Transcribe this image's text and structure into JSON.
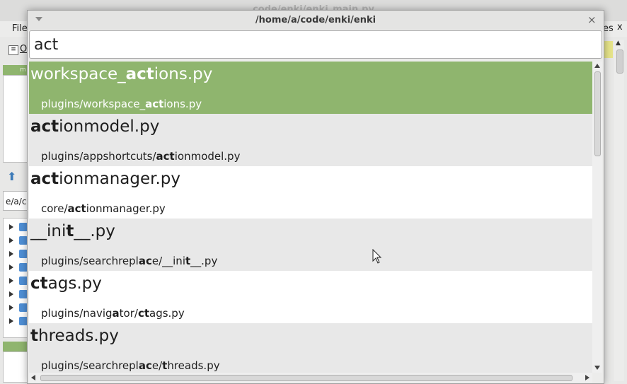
{
  "background_window": {
    "title": "code/enki/enki_main.py",
    "menu_file": "File",
    "menu_right": "es",
    "close": "x",
    "toolbar_text": "O",
    "panel_header": "m",
    "path_field": "e/a/co"
  },
  "dialog": {
    "title": "/home/a/code/enki/enki",
    "search": {
      "value": "act",
      "placeholder": ""
    },
    "colors": {
      "selected": "#8fb56e",
      "row_alt": "#e8e8e8"
    },
    "items": [
      {
        "name_parts": [
          [
            "workspace_",
            false
          ],
          [
            "act",
            true
          ],
          [
            "ions.py",
            false
          ]
        ],
        "path_parts": [
          [
            "plugins/workspace_",
            false
          ],
          [
            "act",
            true
          ],
          [
            "ions.py",
            false
          ]
        ],
        "selected": true
      },
      {
        "name_parts": [
          [
            "act",
            true
          ],
          [
            "ionmodel.py",
            false
          ]
        ],
        "path_parts": [
          [
            "plugins/appshortcuts/",
            false
          ],
          [
            "act",
            true
          ],
          [
            "ionmodel.py",
            false
          ]
        ],
        "selected": false
      },
      {
        "name_parts": [
          [
            "act",
            true
          ],
          [
            "ionmanager.py",
            false
          ]
        ],
        "path_parts": [
          [
            "core/",
            false
          ],
          [
            "act",
            true
          ],
          [
            "ionmanager.py",
            false
          ]
        ],
        "selected": false
      },
      {
        "name_parts": [
          [
            "__ini",
            false
          ],
          [
            "t",
            true
          ],
          [
            "__.py",
            false
          ]
        ],
        "path_parts": [
          [
            "plugins/searchrepl",
            false
          ],
          [
            "ac",
            true
          ],
          [
            "e/__ini",
            false
          ],
          [
            "t",
            true
          ],
          [
            "__.py",
            false
          ]
        ],
        "selected": false
      },
      {
        "name_parts": [
          [
            "ct",
            true
          ],
          [
            "ags.py",
            false
          ]
        ],
        "path_parts": [
          [
            "plugins/navig",
            false
          ],
          [
            "a",
            true
          ],
          [
            "tor/",
            false
          ],
          [
            "ct",
            true
          ],
          [
            "ags.py",
            false
          ]
        ],
        "selected": false
      },
      {
        "name_parts": [
          [
            "t",
            true
          ],
          [
            "hreads.py",
            false
          ]
        ],
        "path_parts": [
          [
            "plugins/searchrepl",
            false
          ],
          [
            "ac",
            true
          ],
          [
            "e/",
            false
          ],
          [
            "t",
            true
          ],
          [
            "hreads.py",
            false
          ]
        ],
        "selected": false
      }
    ]
  }
}
